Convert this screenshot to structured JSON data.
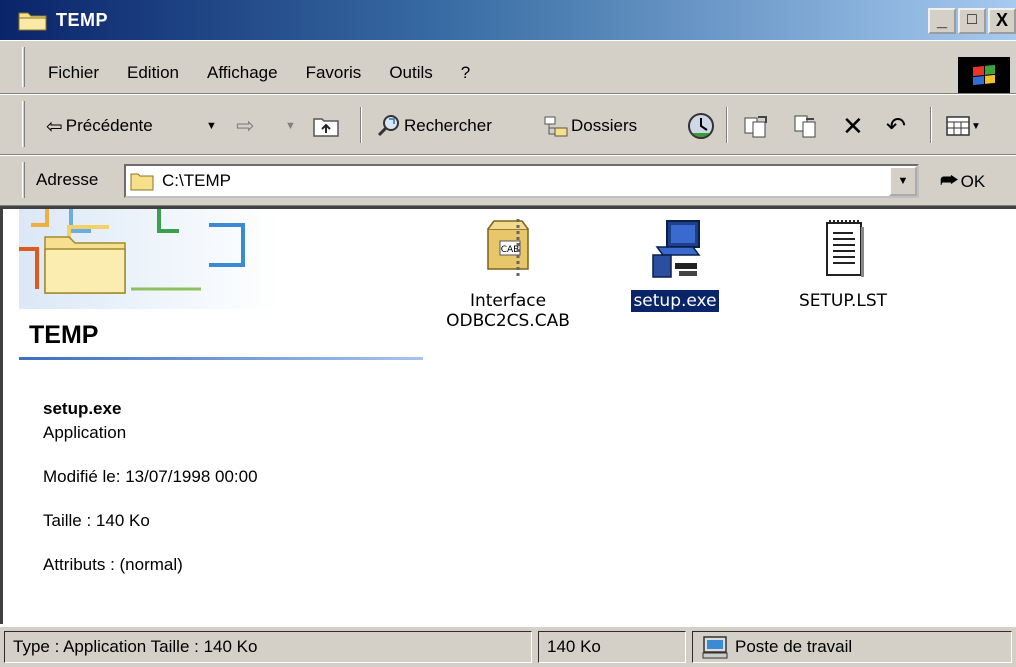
{
  "window": {
    "title": "TEMP",
    "controls": {
      "minimize": "_",
      "maximize": "□",
      "close": "X"
    }
  },
  "menu": {
    "items": [
      "Fichier",
      "Edition",
      "Affichage",
      "Favoris",
      "Outils",
      "?"
    ]
  },
  "toolbar": {
    "back_label": "Précédente",
    "search_label": "Rechercher",
    "folders_label": "Dossiers"
  },
  "address": {
    "label": "Adresse",
    "value": "C:\\TEMP",
    "go_label": "OK"
  },
  "panel": {
    "folder_title": "TEMP",
    "selected_name": "setup.exe",
    "selected_type": "Application",
    "modified": "Modifié le: 13/07/1998 00:00",
    "size": "Taille : 140 Ko",
    "attributes": "Attributs : (normal)"
  },
  "files": [
    {
      "name_line1": "Interface",
      "name_line2": "ODBC2CS.CAB",
      "icon": "cab-archive-icon",
      "selected": false
    },
    {
      "name_line1": "setup.exe",
      "icon": "setup-program-icon",
      "selected": true
    },
    {
      "name_line1": "SETUP.LST",
      "icon": "text-document-icon",
      "selected": false
    }
  ],
  "status": {
    "type_info": "Type : Application Taille  : 140 Ko",
    "size": "140 Ko",
    "zone": "Poste de travail"
  },
  "colors": {
    "title_start": "#0a246a",
    "title_end": "#a6caf0",
    "face": "#d4d0c8",
    "selection": "#0a246a"
  }
}
